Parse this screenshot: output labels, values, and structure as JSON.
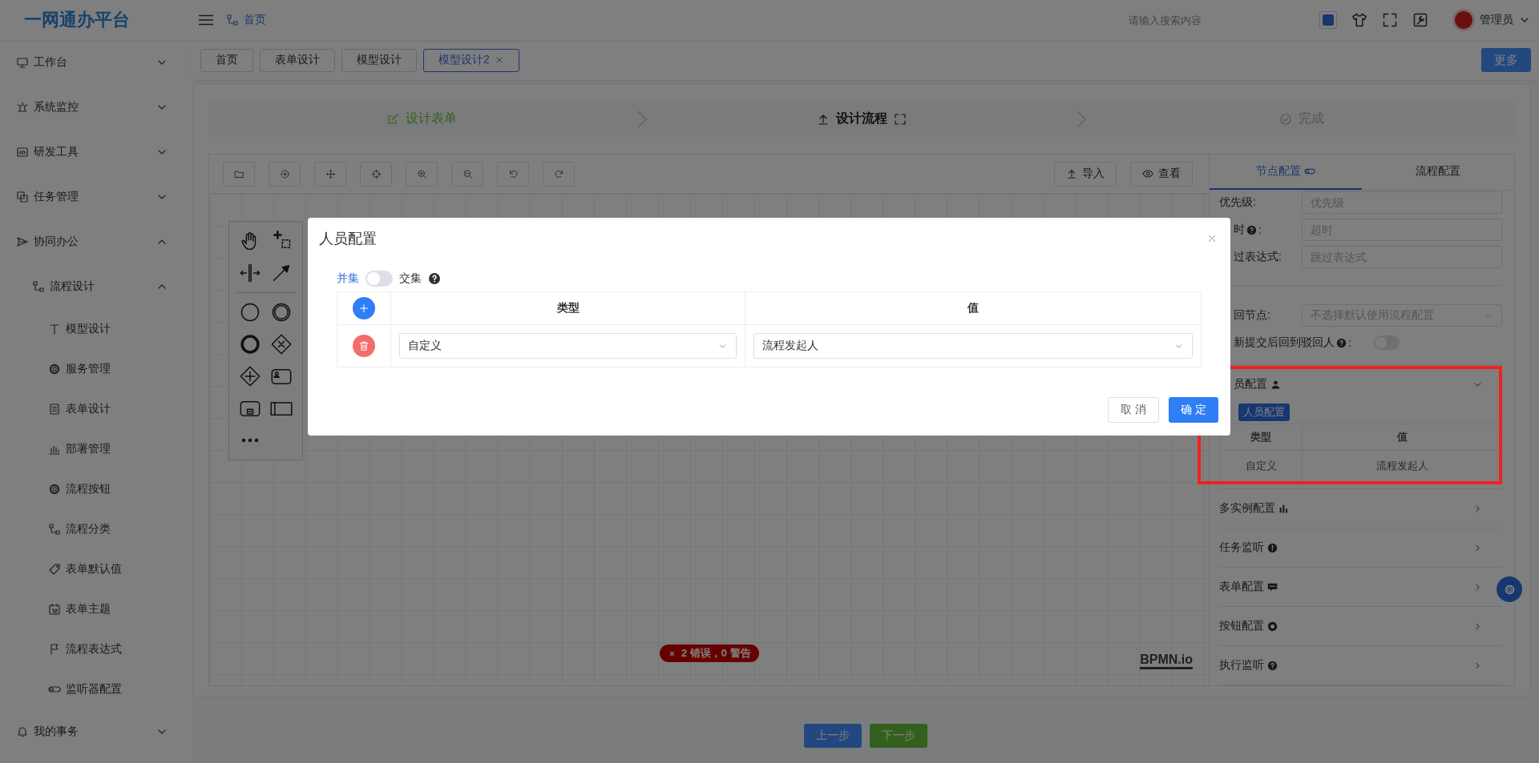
{
  "header": {
    "logo": "一网通办平台",
    "breadcrumb": "首页",
    "search_placeholder": "请输入搜索内容",
    "user": "管理员"
  },
  "sidebar": {
    "items": [
      {
        "label": "工作台",
        "expanded": false
      },
      {
        "label": "系统监控",
        "expanded": false
      },
      {
        "label": "研发工具",
        "expanded": false
      },
      {
        "label": "任务管理",
        "expanded": false
      },
      {
        "label": "协同办公",
        "expanded": true,
        "children": [
          {
            "label": "流程设计",
            "expanded": true,
            "children": [
              {
                "label": "模型设计"
              },
              {
                "label": "服务管理"
              },
              {
                "label": "表单设计"
              },
              {
                "label": "部署管理"
              },
              {
                "label": "流程按钮"
              },
              {
                "label": "流程分类"
              },
              {
                "label": "表单默认值"
              },
              {
                "label": "表单主题"
              },
              {
                "label": "流程表达式"
              },
              {
                "label": "监听器配置"
              }
            ]
          }
        ]
      },
      {
        "label": "我的事务",
        "expanded": false
      }
    ]
  },
  "tags": [
    {
      "label": "首页",
      "selected": false
    },
    {
      "label": "表单设计",
      "selected": false
    },
    {
      "label": "模型设计",
      "selected": false
    },
    {
      "label": "模型设计2",
      "selected": true
    }
  ],
  "more_button": "更多",
  "steps": [
    {
      "label": "设计表单",
      "completed": true,
      "selected": false
    },
    {
      "label": "设计流程",
      "completed": false,
      "selected": true
    },
    {
      "label": "完成",
      "completed": false,
      "selected": false
    }
  ],
  "designer": {
    "toolbar_buttons": [
      "导入",
      "查看"
    ],
    "error_badge": "2 错误，0 警告",
    "logo": "BPMN.io"
  },
  "panel": {
    "tabs": [
      {
        "label": "节点配置",
        "selected": true
      },
      {
        "label": "流程配置",
        "selected": false
      }
    ],
    "fields": [
      {
        "kind": "input",
        "label": "优先级",
        "suffix": ":",
        "placeholder": "优先级"
      },
      {
        "kind": "input",
        "label": "时",
        "suffix": ":",
        "help": true,
        "placeholder": "超时"
      },
      {
        "kind": "input",
        "label": "过表达式",
        "suffix": ":",
        "placeholder": "跳过表达式"
      },
      {
        "kind": "select",
        "label": "回节点",
        "suffix": ":",
        "placeholder": "不选择默认使用流程配置"
      },
      {
        "kind": "switch",
        "label": "新提交后回到驳回人",
        "suffix": ":",
        "help": true,
        "on": false
      }
    ],
    "sections": [
      {
        "title": "员配置",
        "expanded": true,
        "button": "人员配置",
        "columns": [
          "类型",
          "值"
        ],
        "rows": [
          {
            "type": "自定义",
            "value": "流程发起人"
          }
        ]
      },
      {
        "title": "多实例配置",
        "expanded": false
      },
      {
        "title": "任务监听",
        "expanded": false
      },
      {
        "title": "表单配置",
        "expanded": false
      },
      {
        "title": "按钮配置",
        "expanded": false
      },
      {
        "title": "执行监听",
        "expanded": false
      }
    ]
  },
  "dialog": {
    "title": "人员配置",
    "switch": {
      "left_label": "并集",
      "right_label": "交集",
      "on": false
    },
    "columns": [
      "类型",
      "值"
    ],
    "rows": [
      {
        "type": "自定义",
        "value": "流程发起人"
      }
    ],
    "buttons": [
      {
        "label": "取 消",
        "kind": "default"
      },
      {
        "label": "确 定",
        "kind": "primary"
      }
    ]
  },
  "footer_buttons": [
    {
      "label": "上一步",
      "kind": "primary"
    },
    {
      "label": "下一步",
      "kind": "success"
    }
  ]
}
